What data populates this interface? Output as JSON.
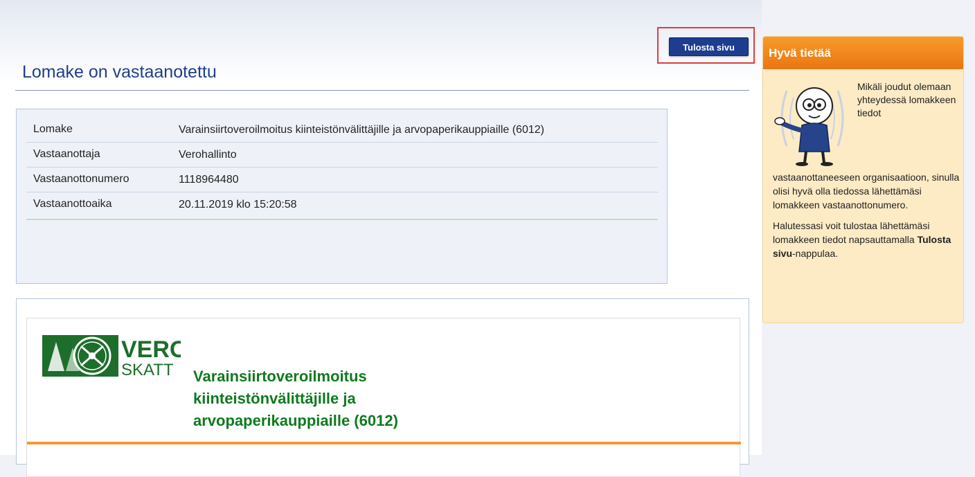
{
  "header": {
    "title": "Lomake on vastaanotettu",
    "print_button_label": "Tulosta sivu"
  },
  "receipt": {
    "rows": [
      {
        "label": "Lomake",
        "value": "Varainsiirtoveroilmoitus kiinteistönvälittäjille ja arvopaperikauppiaille (6012)"
      },
      {
        "label": "Vastaanottaja",
        "value": "Verohallinto"
      },
      {
        "label": "Vastaanottonumero",
        "value": "1118964480"
      },
      {
        "label": "Vastaanottoaika",
        "value": "20.11.2019 klo 15:20:58"
      }
    ]
  },
  "document": {
    "logo_top": "VERO",
    "logo_bottom": "SKATT",
    "title_line1": "Varainsiirtoveroilmoitus",
    "title_line2": "kiinteistönvälittäjille ja",
    "title_line3": "arvopaperikauppiaille (6012)"
  },
  "sidebox": {
    "title": "Hyvä tietää",
    "top_text": "Mikäli joudut olemaan yhteydessä lomakkeen tiedot",
    "body_text": "vastaanottaneeseen organisaatioon, sinulla olisi hyvä olla tiedossa lähettämäsi lomakkeen vastaanottonumero.",
    "print_hint_prefix": "Halutessasi voit tulostaa lähettämäsi lomakkeen tiedot napsauttamalla ",
    "print_hint_bold": "Tulosta sivu",
    "print_hint_suffix": "-nappulaa."
  },
  "colors": {
    "title_blue": "#1e3f8c",
    "button_navy": "#1d3d8f",
    "highlight_red": "#e03c3c",
    "vero_green": "#0e7a1e",
    "accent_orange": "#f39a35"
  },
  "icons": [
    "vero-logo-icon",
    "info-character-icon"
  ]
}
